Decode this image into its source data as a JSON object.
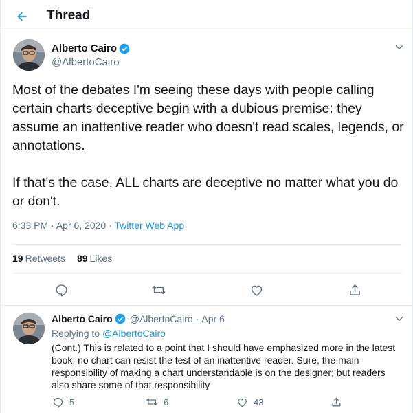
{
  "header": {
    "title": "Thread",
    "back_icon": "arrow-left-icon"
  },
  "colors": {
    "accent": "#1b95e0",
    "text": "#14171a",
    "secondary": "#5b7083",
    "border": "#e6ecf0"
  },
  "main_tweet": {
    "display_name": "Alberto Cairo",
    "handle": "@AlbertoCairo",
    "verified": true,
    "text": "Most of the debates I'm seeing these days with people calling certain charts deceptive begin with a dubious premise: they assume an inattentive reader who doesn't read scales, legends, or annotations.\n\nIf that's the case, ALL charts are deceptive no matter what you do or don't.",
    "time": "6:33 PM",
    "date": "Apr 6, 2020",
    "separator": "·",
    "source": "Twitter Web App",
    "retweets_count": "19",
    "retweets_label": "Retweets",
    "likes_count": "89",
    "likes_label": "Likes"
  },
  "reply_tweet": {
    "display_name": "Alberto Cairo",
    "handle": "@AlbertoCairo",
    "date": "Apr 6",
    "verified": true,
    "replying_prefix": "Replying to",
    "replying_to": "@AlbertoCairo",
    "text": "(Cont.) This is related to a point that I should have emphasized more in the latest book: no chart can resist the test of an inattentive reader. Sure, the main responsibility of making a chart understandable is on the designer; but readers also share some of that responsibility",
    "reply_count": "5",
    "retweet_count": "6",
    "like_count": "43"
  }
}
